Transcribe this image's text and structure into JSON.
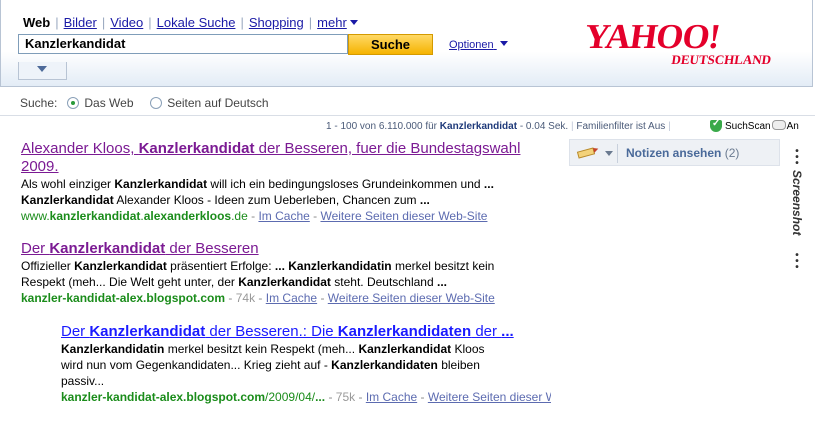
{
  "tabs": [
    {
      "label": "Web",
      "active": true
    },
    {
      "label": "Bilder"
    },
    {
      "label": "Video"
    },
    {
      "label": "Lokale Suche"
    },
    {
      "label": "Shopping"
    },
    {
      "label": "mehr"
    }
  ],
  "search": {
    "value": "Kanzlerkandidat",
    "button": "Suche",
    "options": "Optionen"
  },
  "logo": {
    "main": "YAHOO!",
    "sub": "DEUTSCHLAND",
    "color": "#e4002b"
  },
  "scope": {
    "label": "Suche:",
    "options": [
      "Das Web",
      "Seiten auf Deutsch"
    ]
  },
  "stats": {
    "range": "1 - 100 von 6.110.000 für",
    "query": "Kanzlerkandidat",
    "time": "- 0.04 Sek.",
    "filter": "Familienfilter ist Aus",
    "suchscan": "SuchScan",
    "toggle_text": "An"
  },
  "notizen": {
    "label": "Notizen ansehen",
    "count": "(2)"
  },
  "side_label": "Screenshot",
  "results": [
    {
      "title_a": "Alexander Kloos, ",
      "title_b": "Kanzlerkandidat",
      "title_c": " der Besseren, fuer die Bundestagswahl",
      "title_d": "2009.",
      "l1a": "Als wohl einziger ",
      "l1b": "Kanzlerkandidat",
      "l1c": " will ich ein bedingungsloses Grundeinkommen und ",
      "l1d": "...",
      "l2a": "Kanzlerkandidat",
      "l2b": " Alexander Kloos - Ideen zum Ueberleben, Chancen zum ",
      "l2c": "...",
      "url_a": "www.",
      "url_b": "kanzlerkandidat",
      "url_c": ".",
      "url_d": "alexanderkloos",
      "url_e": ".de",
      "cache": "Im Cache",
      "more": "Weitere Seiten dieser Web-Site"
    },
    {
      "title_a": "Der ",
      "title_b": "Kanzlerkandidat",
      "title_c": " der Besseren",
      "l1a": "Offizieller ",
      "l1b": "Kanzlerkandidat",
      "l1c": " präsentiert Erfolge: ",
      "l1d": "...",
      "l1e": " ",
      "l1f": "Kanzlerkandidatin",
      "l1g": " merkel besitzt kein",
      "l2a": "Respekt (meh... Die Welt geht unter, der ",
      "l2b": "Kanzlerkandidat",
      "l2c": " steht. Deutschland ",
      "l2d": "...",
      "url_a": "kanzler-kandidat-alex.blogspot.com",
      "size": "74k",
      "cache": "Im Cache",
      "more": "Weitere Seiten dieser Web-Site"
    },
    {
      "title_a": "Der ",
      "title_b": "Kanzlerkandidat",
      "title_c": " der Besseren.: Die ",
      "title_d": "Kanzlerkandidaten",
      "title_e": " der ",
      "title_f": "...",
      "l1a": "Kanzlerkandidatin",
      "l1b": " merkel besitzt kein Respekt (meh... ",
      "l1c": "Kanzlerkandidat",
      "l1d": " Kloos",
      "l2a": "wird nun vom Gegenkandidaten... Krieg zieht auf - ",
      "l2b": "Kanzlerkandidaten",
      "l2c": " bleiben",
      "l3": "passiv...",
      "url_a": "kanzler-kandidat-alex.blogspot.com",
      "url_b": "/2009/04/",
      "url_c": "...",
      "size": "75k",
      "cache": "Im Cache",
      "more": "Weitere Seiten dieser Web-Site"
    }
  ]
}
